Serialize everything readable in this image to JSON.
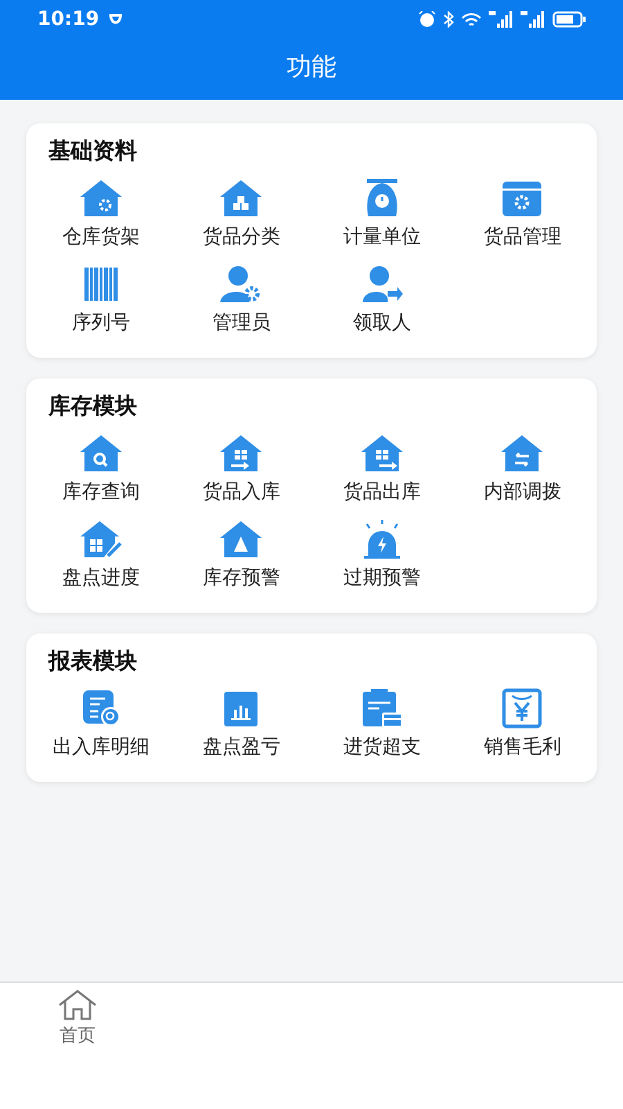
{
  "status_bar": {
    "time": "10:19"
  },
  "header": {
    "title": "功能"
  },
  "sections": [
    {
      "title": "基础资料",
      "items": [
        {
          "label": "仓库货架"
        },
        {
          "label": "货品分类"
        },
        {
          "label": "计量单位"
        },
        {
          "label": "货品管理"
        },
        {
          "label": "序列号"
        },
        {
          "label": "管理员"
        },
        {
          "label": "领取人"
        }
      ]
    },
    {
      "title": "库存模块",
      "items": [
        {
          "label": "库存查询"
        },
        {
          "label": "货品入库"
        },
        {
          "label": "货品出库"
        },
        {
          "label": "内部调拨"
        },
        {
          "label": "盘点进度"
        },
        {
          "label": "库存预警"
        },
        {
          "label": "过期预警"
        }
      ]
    },
    {
      "title": "报表模块",
      "items": [
        {
          "label": "出入库明细"
        },
        {
          "label": "盘点盈亏"
        },
        {
          "label": "进货超支"
        },
        {
          "label": "销售毛利"
        }
      ]
    }
  ],
  "bottom_nav": [
    {
      "label": "首页"
    }
  ]
}
